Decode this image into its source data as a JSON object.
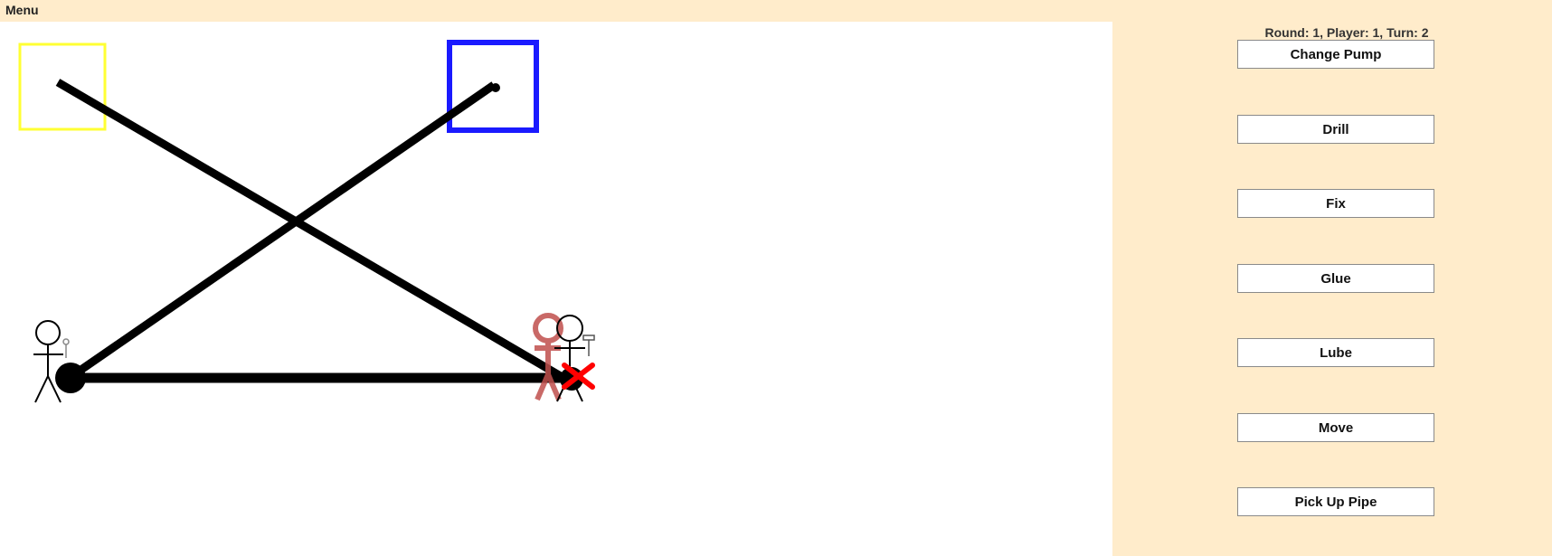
{
  "menu": {
    "label": "Menu"
  },
  "status": {
    "text": "Round: 1, Player: 1, Turn: 2"
  },
  "actions": [
    {
      "label": "Change Pump"
    },
    {
      "label": "Drill"
    },
    {
      "label": "Fix"
    },
    {
      "label": "Glue"
    },
    {
      "label": "Lube"
    },
    {
      "label": "Move"
    },
    {
      "label": "Pick Up Pipe"
    }
  ],
  "colors": {
    "background": "#ffeccb",
    "board": "#ffffff",
    "pipe": "#000000",
    "yellow_tank": "#ffff33",
    "blue_tank": "#1a1aff",
    "damage_marker": "#ff0000",
    "active_player_glow": "#c0504d"
  },
  "icons": {
    "yellow_box": "yellow-cistern-icon",
    "blue_box": "blue-cistern-icon",
    "broken_pipe": "red-x-icon",
    "player": "stickman-icon"
  }
}
